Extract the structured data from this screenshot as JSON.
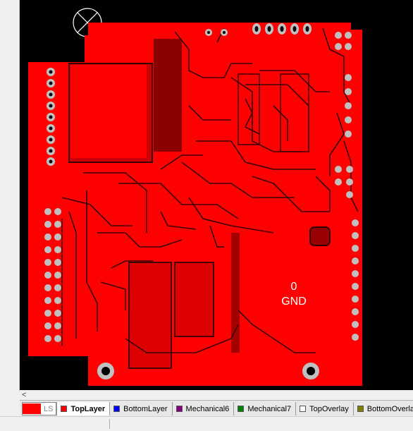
{
  "pcb": {
    "net_number": "0",
    "net_name": "GND",
    "board_color": "#ff0000",
    "background_color": "#000000"
  },
  "scroll": {
    "left_arrow": "<"
  },
  "layer_bar": {
    "ls_label": "LS",
    "tabs": [
      {
        "label": "TopLayer",
        "color": "#ff0000",
        "active": true
      },
      {
        "label": "BottomLayer",
        "color": "#0000ff",
        "active": false
      },
      {
        "label": "Mechanical6",
        "color": "#800080",
        "active": false
      },
      {
        "label": "Mechanical7",
        "color": "#008000",
        "active": false
      },
      {
        "label": "TopOverlay",
        "color": "#ffffff",
        "active": false
      },
      {
        "label": "BottomOverla",
        "color": "#808000",
        "active": false
      }
    ]
  }
}
